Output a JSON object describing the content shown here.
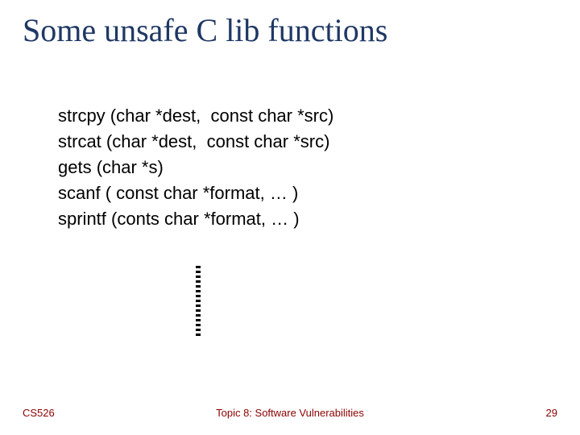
{
  "title": "Some unsafe C lib functions",
  "lines": [
    "strcpy (char *dest,  const char *src)",
    "strcat (char *dest,  const char *src)",
    "gets (char *s)",
    "scanf ( const char *format, … )",
    "sprintf (conts char *format, … )"
  ],
  "footer": {
    "left": "CS526",
    "center": "Topic 8: Software Vulnerabilities",
    "right": "29"
  }
}
